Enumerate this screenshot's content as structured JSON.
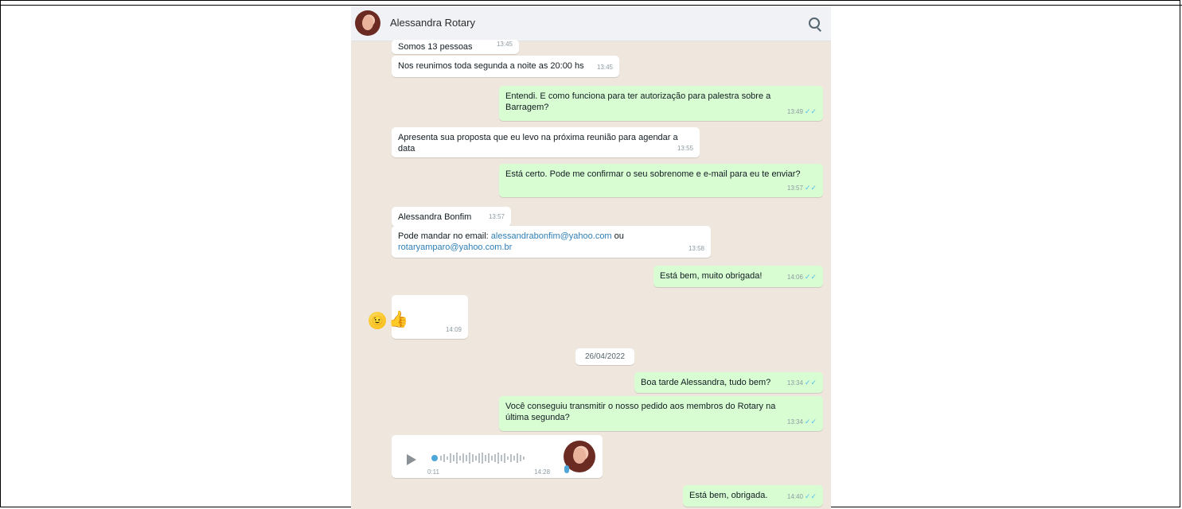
{
  "header": {
    "contact_name": "Alessandra Rotary",
    "search_icon": "search-icon"
  },
  "messages": [
    {
      "text": "Somos 13 pessoas",
      "time": "13:45"
    },
    {
      "text": "Nos reunimos toda segunda a noite as 20:00 hs",
      "time": "13:45"
    },
    {
      "text": "Entendi. E como funciona para ter autorização para palestra sobre a Barragem?",
      "time": "13:49"
    },
    {
      "text": "Apresenta sua proposta que eu levo na próxima reunião para agendar a data",
      "time": "13:55"
    },
    {
      "text": "Está certo. Pode me confirmar o seu sobrenome e e-mail para eu te enviar?",
      "time": "13:57"
    },
    {
      "text": "Alessandra Bonfim",
      "time": "13:57"
    },
    {
      "text_prefix": "Pode mandar no email: ",
      "link1": "alessandrabonfim@yahoo.com",
      "text_mid": " ou",
      "link2": "rotaryamparo@yahoo.com.br",
      "time": "13:58"
    },
    {
      "text": "Está bem, muito obrigada!",
      "time": "14:06"
    },
    {
      "emoji": "😉👍",
      "time": "14:09"
    },
    {
      "text": "Boa tarde Alessandra, tudo bem?",
      "time": "13:34"
    },
    {
      "text": "Você conseguiu transmitir o nosso pedido aos membros do Rotary na última segunda?",
      "time": "13:34"
    },
    {
      "text": "Está bem, obrigada.",
      "time": "14:40"
    }
  ],
  "date_separator": "26/04/2022",
  "voice_message": {
    "duration": "0:11",
    "time": "14:28"
  },
  "colors": {
    "chat_background": "#efe7dd",
    "outgoing_bubble": "#d9fdd3",
    "incoming_bubble": "#ffffff",
    "read_tick": "#53bdeb"
  }
}
